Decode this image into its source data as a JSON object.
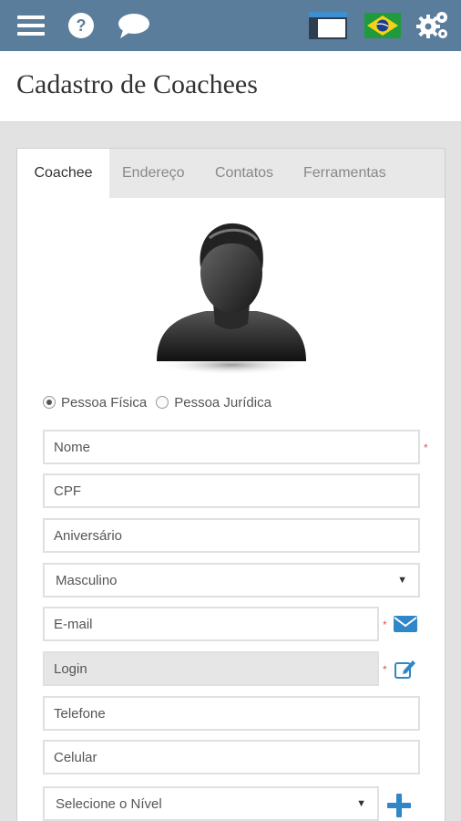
{
  "header": {
    "icons": [
      "hamburger-menu-icon",
      "help-icon",
      "chat-bubble-icon",
      "window-icon",
      "brazil-flag-icon",
      "gears-icon"
    ]
  },
  "page": {
    "title": "Cadastro de Coachees"
  },
  "tabs": [
    {
      "label": "Coachee",
      "active": true
    },
    {
      "label": "Endereço",
      "active": false
    },
    {
      "label": "Contatos",
      "active": false
    },
    {
      "label": "Ferramentas",
      "active": false
    }
  ],
  "person_type": {
    "options": [
      "Pessoa Física",
      "Pessoa Jurídica"
    ],
    "selected": "Pessoa Física"
  },
  "form": {
    "nome": {
      "placeholder": "Nome",
      "required": true
    },
    "cpf": {
      "placeholder": "CPF"
    },
    "aniversario": {
      "placeholder": "Aniversário"
    },
    "sexo": {
      "value": "Masculino"
    },
    "email": {
      "placeholder": "E-mail",
      "required": true
    },
    "login": {
      "placeholder": "Login",
      "required": true
    },
    "telefone": {
      "placeholder": "Telefone"
    },
    "celular": {
      "placeholder": "Celular"
    },
    "nivel": {
      "value": "Selecione o Nível"
    }
  },
  "required_marker": "*",
  "colors": {
    "header": "#5b7d9c",
    "accent": "#2f86c8",
    "required": "#e25555"
  }
}
